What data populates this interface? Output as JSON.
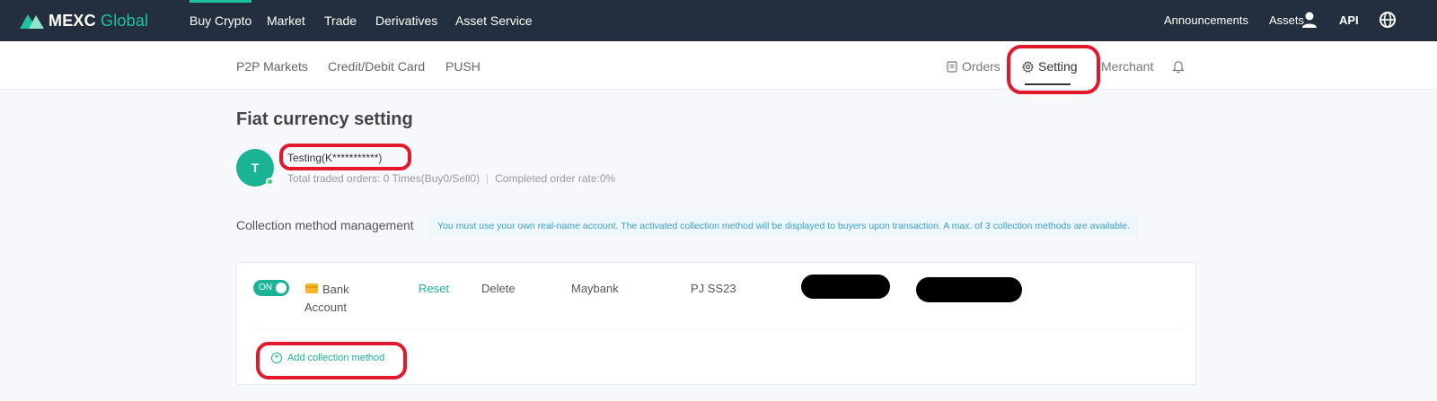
{
  "brand": {
    "name_bold": "MEXC",
    "name_light": "Global",
    "accent": "#1ec39b"
  },
  "top_nav": {
    "items": [
      "Buy Crypto",
      "Market",
      "Trade",
      "Derivatives",
      "Asset Service"
    ],
    "right": {
      "announcements": "Announcements",
      "assets": "Assets",
      "api": "API"
    },
    "icons": [
      "user-icon",
      "globe-icon"
    ]
  },
  "sub_nav": {
    "items": [
      "P2P Markets",
      "Credit/Debit Card",
      "PUSH"
    ],
    "right": {
      "orders": "Orders",
      "setting": "Setting",
      "merchant": "Merchant"
    },
    "icons": [
      "orders-icon",
      "gear-icon",
      "bell-icon"
    ]
  },
  "page": {
    "title": "Fiat currency setting",
    "user": {
      "avatar_letter": "T",
      "name": "Testing(K***********)",
      "stats": "Total traded orders: 0 Times(Buy0/Sell0)",
      "completion": "Completed order rate:0%"
    },
    "collection": {
      "title": "Collection method management",
      "notice": "You must use your own real-name account. The activated collection method will be displayed to buyers upon transaction. A max. of 3 collection methods are available.",
      "methods": [
        {
          "toggle": "ON",
          "type": "Bank Account",
          "reset": "Reset",
          "delete": "Delete",
          "bank": "Maybank",
          "holder": "PJ SS23"
        }
      ],
      "add_label": "Add collection method"
    }
  },
  "colors": {
    "nav_bg": "#232f3e",
    "highlight": "#e3182d",
    "green": "#1ab394"
  }
}
